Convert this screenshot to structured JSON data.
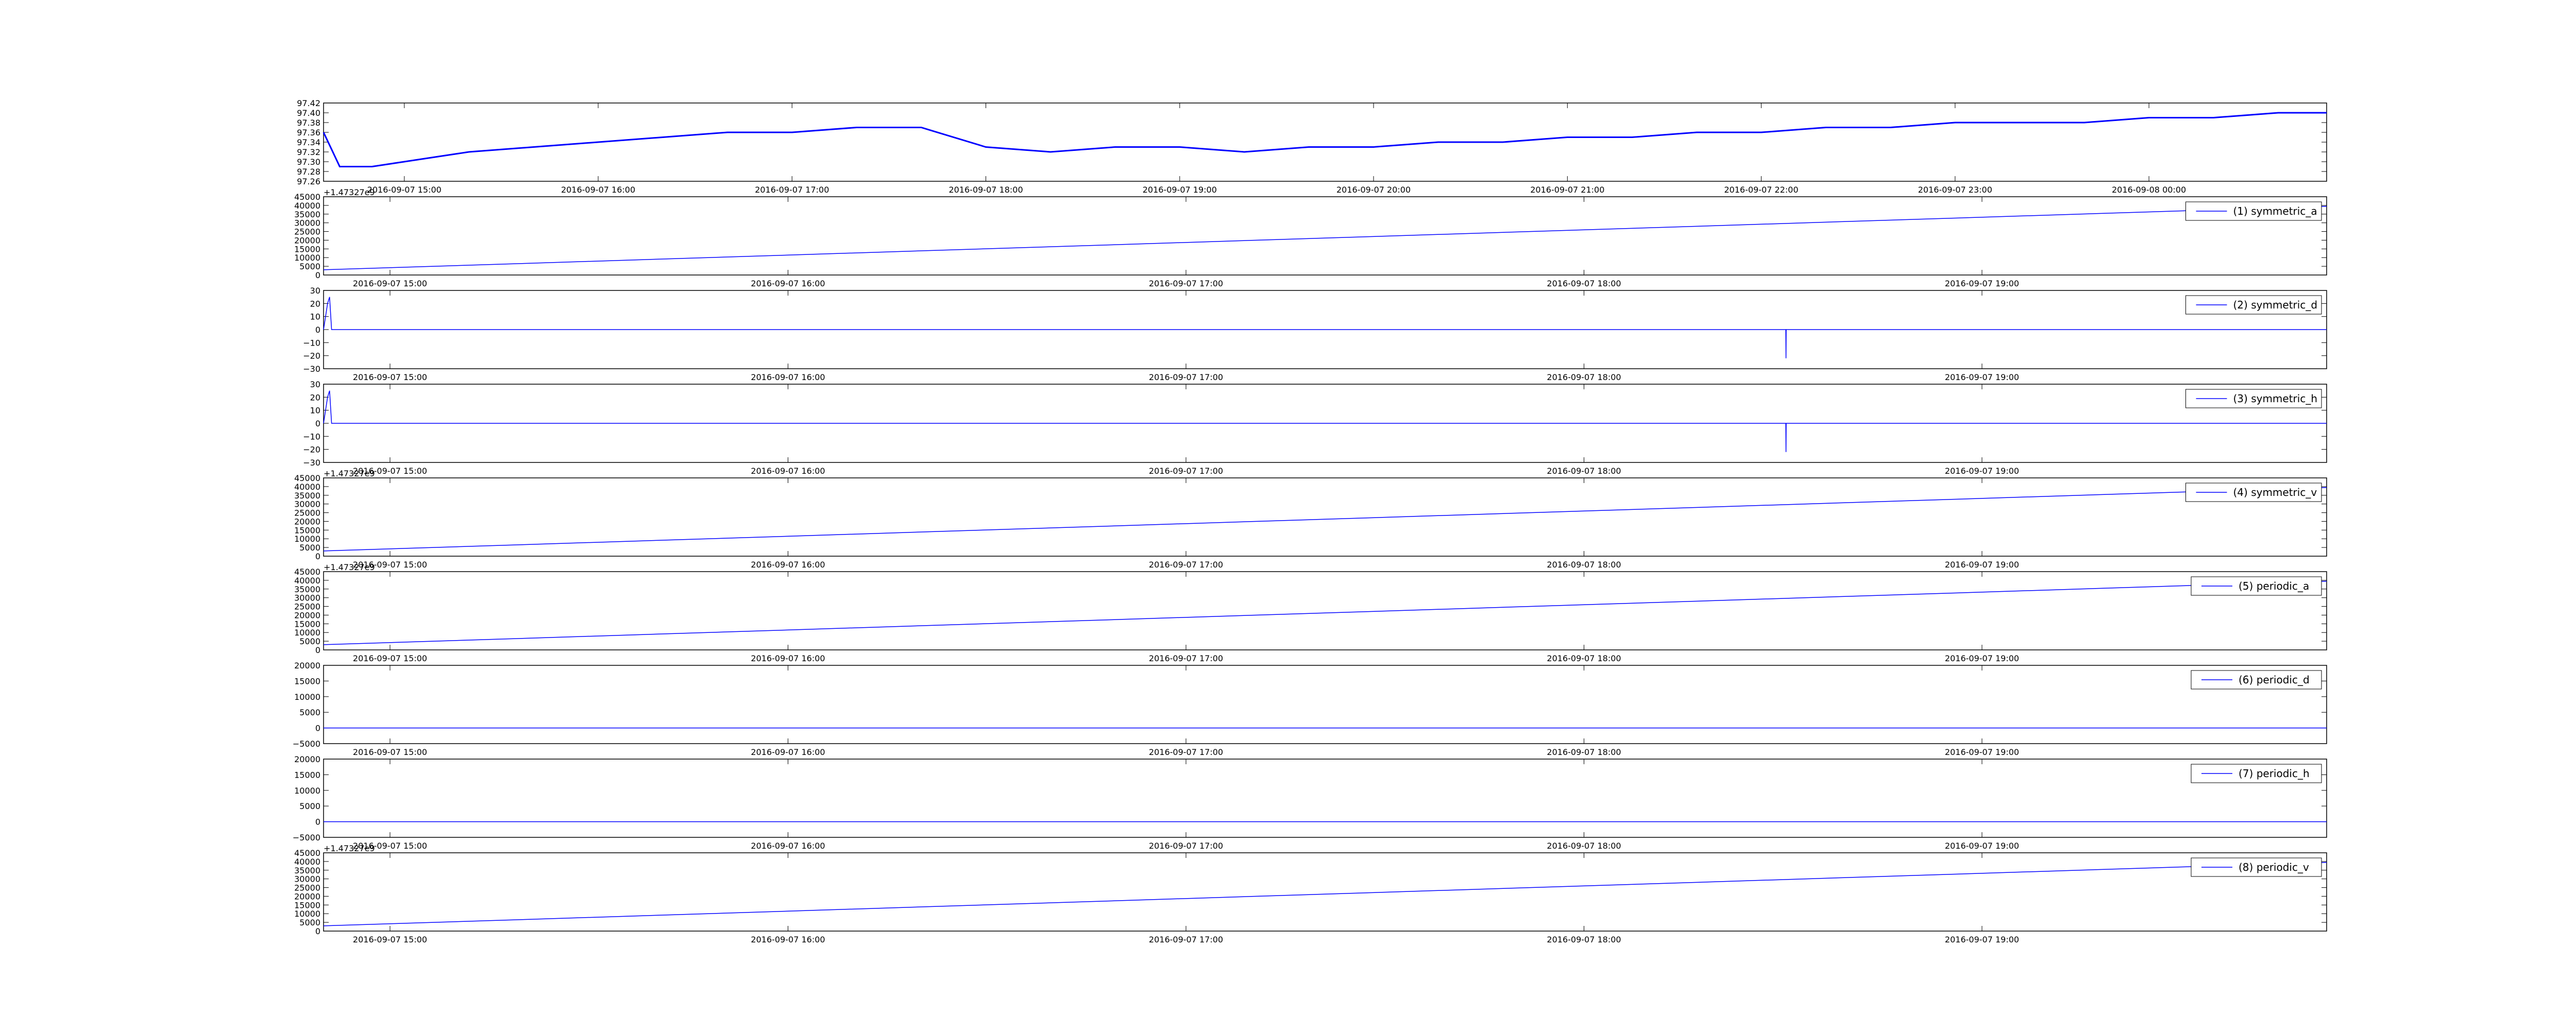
{
  "colors": {
    "line": "#0000ff",
    "axes": "#000000",
    "background": "#ffffff"
  },
  "chart_data": [
    {
      "type": "line",
      "title": "",
      "xlabel": "",
      "ylabel": "",
      "grid": false,
      "x_start": "2016-09-07 14:35",
      "x_end": "2016-09-08 00:55",
      "xticks": [
        "2016-09-07 15:00",
        "2016-09-07 16:00",
        "2016-09-07 17:00",
        "2016-09-07 18:00",
        "2016-09-07 19:00",
        "2016-09-07 20:00",
        "2016-09-07 21:00",
        "2016-09-07 22:00",
        "2016-09-07 23:00",
        "2016-09-08 00:00"
      ],
      "ylim": [
        97.26,
        97.42
      ],
      "yticks": [
        "97.26",
        "97.28",
        "97.30",
        "97.32",
        "97.34",
        "97.36",
        "97.38",
        "97.40",
        "97.42"
      ],
      "series": [
        {
          "x": [
            "2016-09-07 14:35",
            "2016-09-07 14:40",
            "2016-09-07 14:50",
            "2016-09-07 15:00",
            "2016-09-07 15:20",
            "2016-09-07 15:40",
            "2016-09-07 16:00",
            "2016-09-07 16:20",
            "2016-09-07 16:40",
            "2016-09-07 17:00",
            "2016-09-07 17:20",
            "2016-09-07 17:40",
            "2016-09-07 18:00",
            "2016-09-07 18:20",
            "2016-09-07 18:40",
            "2016-09-07 19:00",
            "2016-09-07 19:20",
            "2016-09-07 19:40",
            "2016-09-07 20:00",
            "2016-09-07 20:20",
            "2016-09-07 20:40",
            "2016-09-07 21:00",
            "2016-09-07 21:20",
            "2016-09-07 21:40",
            "2016-09-07 22:00",
            "2016-09-07 22:20",
            "2016-09-07 22:40",
            "2016-09-07 23:00",
            "2016-09-07 23:20",
            "2016-09-07 23:40",
            "2016-09-08 00:00",
            "2016-09-08 00:20",
            "2016-09-08 00:40",
            "2016-09-08 00:55"
          ],
          "values": [
            97.36,
            97.29,
            97.29,
            97.3,
            97.32,
            97.33,
            97.34,
            97.35,
            97.36,
            97.36,
            97.37,
            97.37,
            97.33,
            97.32,
            97.33,
            97.33,
            97.32,
            97.33,
            97.33,
            97.34,
            97.34,
            97.35,
            97.35,
            97.36,
            97.36,
            97.37,
            97.37,
            97.38,
            97.38,
            97.38,
            97.39,
            97.39,
            97.4,
            97.4
          ]
        }
      ]
    },
    {
      "type": "line",
      "offset_label": "+1.47327e9",
      "ylim": [
        0,
        45000
      ],
      "yticks": [
        "0",
        "5000",
        "10000",
        "15000",
        "20000",
        "25000",
        "30000",
        "35000",
        "40000",
        "45000"
      ],
      "xticks": [
        "2016-09-07 15:00",
        "2016-09-07 16:00",
        "2016-09-07 17:00",
        "2016-09-07 18:00",
        "2016-09-07 19:00"
      ],
      "legend_position": "upper right",
      "series": [
        {
          "name": "(1) symmetric_a",
          "x": [
            0,
            1
          ],
          "values": [
            3000,
            39500
          ]
        }
      ]
    },
    {
      "type": "line",
      "ylim": [
        -30,
        30
      ],
      "yticks": [
        "−30",
        "−20",
        "−10",
        "0",
        "10",
        "20",
        "30"
      ],
      "xticks": [
        "2016-09-07 15:00",
        "2016-09-07 16:00",
        "2016-09-07 17:00",
        "2016-09-07 18:00",
        "2016-09-07 19:00"
      ],
      "legend_position": "upper right",
      "series": [
        {
          "name": "(2) symmetric_d",
          "x": [
            0,
            0.001,
            0.002,
            0.003,
            0.004,
            0.73,
            0.7301,
            0.7302,
            1
          ],
          "values": [
            0,
            10,
            20,
            25,
            0,
            0,
            -22,
            0,
            0
          ]
        }
      ]
    },
    {
      "type": "line",
      "ylim": [
        -30,
        30
      ],
      "yticks": [
        "−30",
        "−20",
        "−10",
        "0",
        "10",
        "20",
        "30"
      ],
      "xticks": [
        "2016-09-07 15:00",
        "2016-09-07 16:00",
        "2016-09-07 17:00",
        "2016-09-07 18:00",
        "2016-09-07 19:00"
      ],
      "legend_position": "upper right",
      "series": [
        {
          "name": "(3) symmetric_h",
          "x": [
            0,
            0.001,
            0.002,
            0.003,
            0.004,
            0.73,
            0.7301,
            0.7302,
            1
          ],
          "values": [
            0,
            10,
            20,
            25,
            0,
            0,
            -22,
            0,
            0
          ]
        }
      ]
    },
    {
      "type": "line",
      "offset_label": "+1.47327e9",
      "ylim": [
        0,
        45000
      ],
      "yticks": [
        "0",
        "5000",
        "10000",
        "15000",
        "20000",
        "25000",
        "30000",
        "35000",
        "40000",
        "45000"
      ],
      "xticks": [
        "2016-09-07 15:00",
        "2016-09-07 16:00",
        "2016-09-07 17:00",
        "2016-09-07 18:00",
        "2016-09-07 19:00"
      ],
      "legend_position": "upper right",
      "series": [
        {
          "name": "(4) symmetric_v",
          "x": [
            0,
            1
          ],
          "values": [
            3000,
            39500
          ]
        }
      ]
    },
    {
      "type": "line",
      "offset_label": "+1.47327e9",
      "ylim": [
        0,
        45000
      ],
      "yticks": [
        "0",
        "5000",
        "10000",
        "15000",
        "20000",
        "25000",
        "30000",
        "35000",
        "40000",
        "45000"
      ],
      "xticks": [
        "2016-09-07 15:00",
        "2016-09-07 16:00",
        "2016-09-07 17:00",
        "2016-09-07 18:00",
        "2016-09-07 19:00"
      ],
      "legend_position": "upper right",
      "series": [
        {
          "name": "(5) periodic_a",
          "x": [
            0,
            1
          ],
          "values": [
            3000,
            39500
          ]
        }
      ]
    },
    {
      "type": "line",
      "ylim": [
        -5000,
        20000
      ],
      "yticks": [
        "−5000",
        "0",
        "5000",
        "10000",
        "15000",
        "20000"
      ],
      "xticks": [
        "2016-09-07 15:00",
        "2016-09-07 16:00",
        "2016-09-07 17:00",
        "2016-09-07 18:00",
        "2016-09-07 19:00"
      ],
      "legend_position": "upper right",
      "series": [
        {
          "name": "(6) periodic_d",
          "x": [
            0,
            1
          ],
          "values": [
            0,
            0
          ]
        }
      ]
    },
    {
      "type": "line",
      "ylim": [
        -5000,
        20000
      ],
      "yticks": [
        "−5000",
        "0",
        "5000",
        "10000",
        "15000",
        "20000"
      ],
      "xticks": [
        "2016-09-07 15:00",
        "2016-09-07 16:00",
        "2016-09-07 17:00",
        "2016-09-07 18:00",
        "2016-09-07 19:00"
      ],
      "legend_position": "upper right",
      "series": [
        {
          "name": "(7) periodic_h",
          "x": [
            0,
            1
          ],
          "values": [
            0,
            0
          ]
        }
      ]
    },
    {
      "type": "line",
      "offset_label": "+1.47327e9",
      "ylim": [
        0,
        45000
      ],
      "yticks": [
        "0",
        "5000",
        "10000",
        "15000",
        "20000",
        "25000",
        "30000",
        "35000",
        "40000",
        "45000"
      ],
      "xticks": [
        "2016-09-07 15:00",
        "2016-09-07 16:00",
        "2016-09-07 17:00",
        "2016-09-07 18:00",
        "2016-09-07 19:00"
      ],
      "legend_position": "upper right",
      "series": [
        {
          "name": "(8) periodic_v",
          "x": [
            0,
            1
          ],
          "values": [
            3000,
            39500
          ]
        }
      ]
    }
  ]
}
